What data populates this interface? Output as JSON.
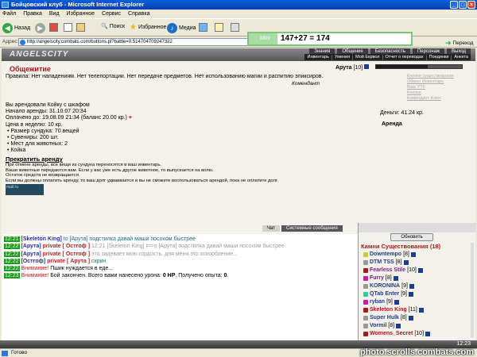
{
  "window": {
    "title": "Бойцовский клуб - Microsoft Internet Explorer"
  },
  "menu": [
    "Файл",
    "Правка",
    "Вид",
    "Избранное",
    "Сервис",
    "Справка"
  ],
  "toolbar": {
    "back": "Назад",
    "search": "Поиск",
    "favorites": "Избранное",
    "media": "Медиа"
  },
  "address": {
    "label": "Адрес:",
    "url": "http://angelscity.combats.com/buttons.pl?battle=0.514704709247322",
    "go": "Переход"
  },
  "calc": {
    "label": "Mini",
    "expression": "147+27 = 174"
  },
  "game": {
    "logo": "ANGELSCITY",
    "tabs": [
      "Знания",
      "Общение",
      "Безопасность",
      "Персонаж",
      "Выход"
    ],
    "subtabs": [
      "Инвентарь",
      "Умения",
      "Мой Екрвол",
      "Отчет о переводах",
      "Поединки",
      "Анкета"
    ],
    "room": "Общежитие",
    "rules": "Правила: Нет нападениям. Нет телепортации. Нет передаче предметов. Нет использованию магии и распитию эликсиров.",
    "komm": "Комендант",
    "player_name": "Арута",
    "player_level": "[10]",
    "menu_info": [
      "Кнопки существования",
      "Обмен Инвентарь",
      "Ваш YTF",
      "Кнопки",
      "Комендант Ключ"
    ],
    "rent": {
      "line1": "Вы арендовали Койку с шкафом",
      "line2": "Начало аренды: 31.10.07 20:34",
      "line3": "Оплачено до: 19.08.09 21:34 (баланс 20.00 кр.)",
      "line4": "Цена в неделю: 10 кр.",
      "items": [
        "Размер сундука: 70 вещей",
        "Сувениры: 200 шт.",
        "Мест для животных: 2",
        "Койка"
      ]
    },
    "money": "Деньги: 41.24 кр.",
    "arenda": "Аренда",
    "stop": "Прекратить аренду",
    "warn": [
      "При отмене аренды, все вещи из сундука переносятся в ваш инвентарь.",
      "Ваши животные передаются вам. Если у вас уже есть другое животное, то выпускается на волю.",
      "Остаток средств не возвращается.",
      "Если вы должны оплатить аренду, то ваш долг удваивается и вы не сможете воспользоваться арендой, пока не оплатите долг."
    ],
    "banner": "mail.ru"
  },
  "chat": {
    "tab_chat": "Чат",
    "tab_system": "Системные сообщения",
    "lines": [
      {
        "time": "12:21",
        "sender": "[Skeleton King]",
        "mid": " to ",
        "target": "[Арута]",
        "text": " подстилка давай маши посохом быстрее"
      },
      {
        "time": "12:22",
        "sender": "[Арута]",
        "prefix": "private [ Остгоф ]",
        "text": " 12:21 [Skeleton King] t==o [Арута] подстилка давай маши посохом быстрее"
      },
      {
        "time": "12:22",
        "sender": "[Арута]",
        "prefix": "private [ Остгоф ]",
        "text": " это задевает мою гордость, для меня это оскорбление..."
      },
      {
        "time": "12:22",
        "sender": "[Остгоф]",
        "prefix": "private [ Арута ]",
        "text": " скрин"
      },
      {
        "time": "12:22",
        "label": "Внимание!",
        "text": " Пшик нуждается в еде..."
      },
      {
        "time": "12:23",
        "label": "Внимание!",
        "text": " Бой закончен. Всего вами нанесено урона: ",
        "bold": "0 HP",
        "text2": ". Получено опыта: ",
        "bold2": "0",
        "text3": "."
      }
    ]
  },
  "online": {
    "refresh": "Обновить",
    "header": "Камни Существования (18)",
    "users": [
      {
        "name": "Downtempo",
        "lvl": "[8]",
        "c": "#1c3e8c"
      },
      {
        "name": "DTM TSS",
        "lvl": "[8]",
        "c": "#1c3e8c"
      },
      {
        "name": "Fearless Stile",
        "lvl": "[10]",
        "c": "#7a1c8c"
      },
      {
        "name": "Furry",
        "lvl": "[8]",
        "c": "#7a1c8c"
      },
      {
        "name": "KORONINA",
        "lvl": "[9]",
        "c": "#1c3e8c"
      },
      {
        "name": "QTab Enter",
        "lvl": "[9]",
        "c": "#1c3e8c"
      },
      {
        "name": "ryban",
        "lvl": "[9]",
        "c": "#1c3e8c"
      },
      {
        "name": "Skeleton King",
        "lvl": "[11]",
        "c": "#a21c1c"
      },
      {
        "name": "Super Hulk",
        "lvl": "[8]",
        "c": "#1c3e8c"
      },
      {
        "name": "Vormil",
        "lvl": "[8]",
        "c": "#1c3e8c"
      },
      {
        "name": "Womens_Secret",
        "lvl": "[10]",
        "c": "#a21c1c"
      }
    ]
  },
  "taskbar": {
    "clock": "12:23"
  },
  "status": {
    "text": "Готово"
  },
  "watermark": "photo.scrolls.combats.com"
}
